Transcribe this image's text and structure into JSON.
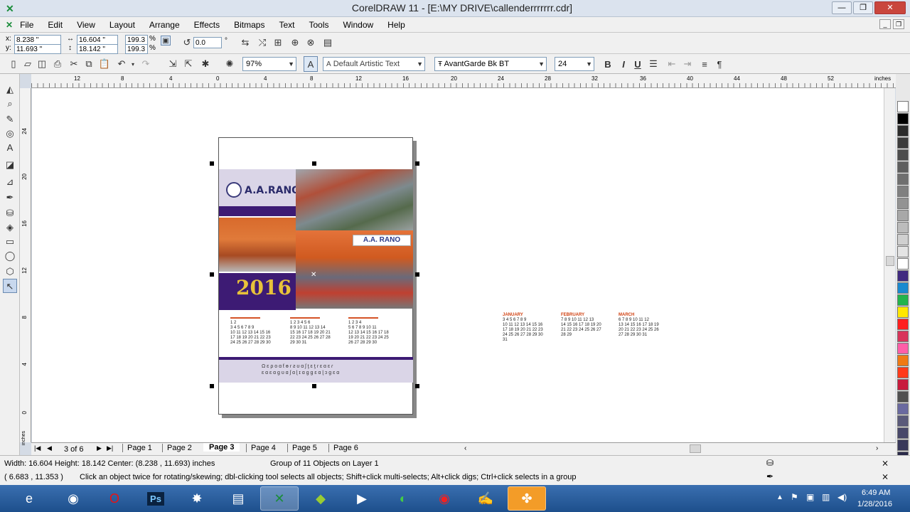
{
  "window": {
    "title": "CorelDRAW 11 - [E:\\MY DRIVE\\callenderrrrrrr.cdr]"
  },
  "menu": [
    "File",
    "Edit",
    "View",
    "Layout",
    "Arrange",
    "Effects",
    "Bitmaps",
    "Text",
    "Tools",
    "Window",
    "Help"
  ],
  "props": {
    "x": "8.238 \"",
    "y": "11.693 \"",
    "w": "16.604 \"",
    "h": "18.142 \"",
    "scale_x": "199.3",
    "scale_y": "199.3",
    "pct": "%",
    "rotation": "0.0",
    "deg": "°"
  },
  "std": {
    "zoom": "97%",
    "style": "Default Artistic Text",
    "font": "AvantGarde Bk BT",
    "size": "24",
    "bold": "B",
    "italic": "I",
    "underline": "U",
    "para": "¶"
  },
  "ruler": {
    "h_ticks": [
      "12",
      "8",
      "4",
      "0",
      "4",
      "8",
      "12",
      "16",
      "20",
      "24",
      "28",
      "32",
      "36",
      "40",
      "44",
      "48",
      "52"
    ],
    "v_ticks": [
      "24",
      "20",
      "16",
      "12",
      "8",
      "4",
      "0"
    ],
    "unit": "inches"
  },
  "page_nav": {
    "counter": "3 of 6",
    "tabs": [
      "Page 1",
      "Page 2",
      "Page 3",
      "Page 4",
      "Page 5",
      "Page 6"
    ],
    "active": "Page 3"
  },
  "design": {
    "brand": "A.A.RANO",
    "brand2": "A.A. RANO",
    "year": "2016",
    "footer1": "Ω ɛ ρ o ɑ ƭ ɵ ɾ ƨ ʊ ɑ ʃ ƫ ɛ ƫ ɾ ɛ ɑ ɛ ɾ",
    "footer2": "ɛ ɑ ɛ ɑ ɡ ʊ ɑ ʃ ɑ ɭ ɪ ɑ ɡ ɡ ɛ ɑ ɭ ɔ ɡ ɛ ɑ",
    "cal_header": "▬▬▬▬▬▬▬",
    "cal_rows_a": [
      "            1    2",
      "3   4   5   6   7   8   9",
      "10 11 12 13 14 15 16",
      "17 18 19 20 21 22 23",
      "24 25 26 27 28 29 30"
    ],
    "cal_rows_b": [
      "1    2   3   4   5   6",
      "8    9  10 11 12 13 14",
      "15 16 17 18 19 20 21",
      "22 23 24 25 26 27 28",
      "29 30 31"
    ],
    "cal_rows_c": [
      "            1    2   3   4",
      "5   6   7   8   9  10 11",
      "12 13 14 15 16 17 18",
      "19 20 21 22 23 24 25",
      "26 27 28 29 30"
    ]
  },
  "side_cal": {
    "months": [
      "JANUARY",
      "FEBRUARY",
      "MARCH"
    ],
    "jan": [
      "3  4  5  6  7  8  9",
      "10 11 12 13 14 15 16",
      "17 18 19 20 21 22 23",
      "24 25 26 27 28 29 30",
      "31"
    ],
    "feb": [
      "7  8  9 10 11 12 13",
      "14 15 16 17 18 19 20",
      "21 22 23 24 25 26 27",
      "28 29"
    ],
    "mar": [
      "6  7  8  9 10 11 12",
      "13 14 15 16 17 18 19",
      "20 21 22 23 24 25 26",
      "27 28 29 30 31"
    ]
  },
  "status": {
    "size": "Width: 16.604  Height: 18.142  Center: (8.238 , 11.693)  inches",
    "layer": "Group of 11 Objects on Layer 1",
    "coords": "( 6.683 , 11.353 )",
    "hint": "Click an object twice for rotating/skewing; dbl-clicking tool selects all objects; Shift+click multi-selects; Alt+click digs; Ctrl+click selects in a group"
  },
  "clock": {
    "time": "6:49 AM",
    "date": "1/28/2016"
  },
  "palette": [
    "#ffffff",
    "#000000",
    "#2b2b2b",
    "#3c3c3c",
    "#4d4d4d",
    "#5e5e5e",
    "#6f6f6f",
    "#808080",
    "#939393",
    "#a8a8a8",
    "#bcbcbc",
    "#d0d0d0",
    "#e4e4e4",
    "#ffffff",
    "#402a80",
    "#1a8ad0",
    "#23b44c",
    "#ffe800",
    "#ff1e1e",
    "#d8345a",
    "#ff5ea8",
    "#f07a14",
    "#ff3a1a",
    "#c81a3c",
    "#505050",
    "#6a6aa0",
    "#5a5a7a",
    "#48486a",
    "#38385a",
    "#2a2a4a"
  ]
}
